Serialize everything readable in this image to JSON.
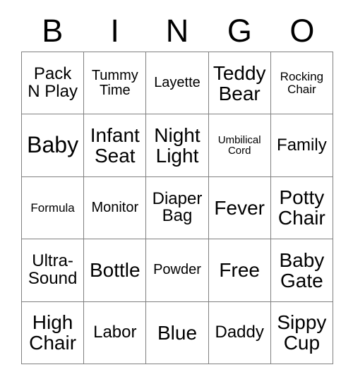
{
  "card": {
    "header_letters": [
      "B",
      "I",
      "N",
      "G",
      "O"
    ],
    "free_space_label": "Free",
    "grid_line_color": "#808080",
    "text_color": "#000000",
    "background_color": "#ffffff",
    "columns": 5,
    "rows": 5,
    "rows_data": [
      [
        {
          "text": "Pack\nN Play",
          "size": "md"
        },
        {
          "text": "Tummy\nTime",
          "size": "sm"
        },
        {
          "text": "Layette",
          "size": "sm"
        },
        {
          "text": "Teddy\nBear",
          "size": "lg"
        },
        {
          "text": "Rocking\nChair",
          "size": "xs"
        }
      ],
      [
        {
          "text": "Baby",
          "size": "xl"
        },
        {
          "text": "Infant\nSeat",
          "size": "lg"
        },
        {
          "text": "Night\nLight",
          "size": "lg"
        },
        {
          "text": "Umbilical\nCord",
          "size": "xxs"
        },
        {
          "text": "Family",
          "size": "md"
        }
      ],
      [
        {
          "text": "Formula",
          "size": "xs"
        },
        {
          "text": "Monitor",
          "size": "sm"
        },
        {
          "text": "Diaper\nBag",
          "size": "md"
        },
        {
          "text": "Fever",
          "size": "lg"
        },
        {
          "text": "Potty\nChair",
          "size": "lg"
        }
      ],
      [
        {
          "text": "Ultra-\nSound",
          "size": "md"
        },
        {
          "text": "Bottle",
          "size": "lg"
        },
        {
          "text": "Powder",
          "size": "sm"
        },
        {
          "text": "Free",
          "size": "lg"
        },
        {
          "text": "Baby\nGate",
          "size": "lg"
        }
      ],
      [
        {
          "text": "High\nChair",
          "size": "lg"
        },
        {
          "text": "Labor",
          "size": "md"
        },
        {
          "text": "Blue",
          "size": "lg"
        },
        {
          "text": "Daddy",
          "size": "md"
        },
        {
          "text": "Sippy\nCup",
          "size": "lg"
        }
      ]
    ]
  }
}
